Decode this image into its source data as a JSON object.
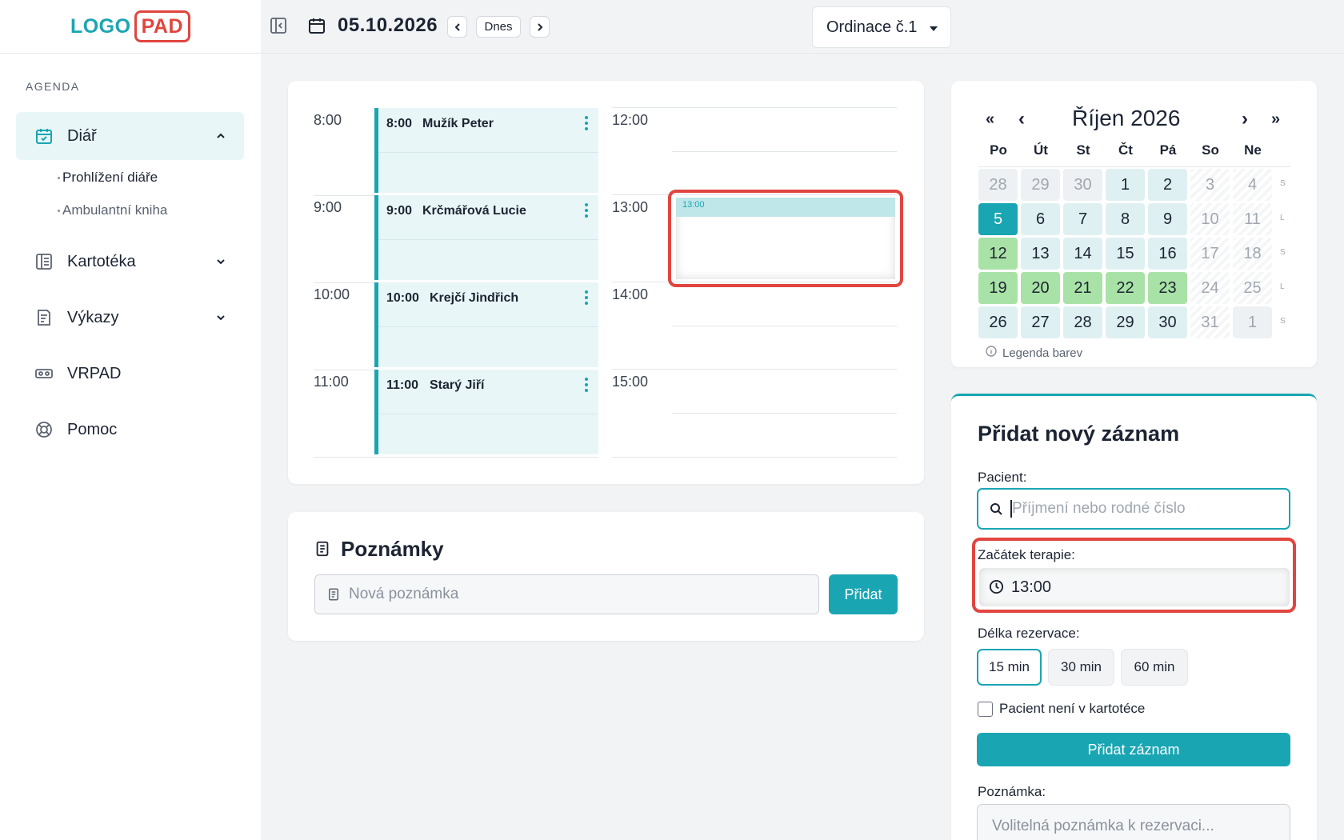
{
  "logo": {
    "part1": "LOGO",
    "part2": "PAD"
  },
  "sidebar": {
    "section_label": "AGENDA",
    "items": [
      {
        "label": "Diář",
        "icon": "calendar-check-icon",
        "active": true
      },
      {
        "label": "Kartotéka",
        "icon": "book-icon"
      },
      {
        "label": "Výkazy",
        "icon": "report-icon"
      },
      {
        "label": "VRPAD",
        "icon": "vr-headset-icon"
      },
      {
        "label": "Pomoc",
        "icon": "lifebuoy-icon"
      }
    ],
    "subitems": [
      {
        "label": "Prohlížení diáře"
      },
      {
        "label": "Ambulantní kniha"
      }
    ]
  },
  "topbar": {
    "date": "05.10.2026",
    "today_label": "Dnes",
    "office_select": "Ordinace č.1"
  },
  "schedule": {
    "times_left": [
      "8:00",
      "9:00",
      "10:00",
      "11:00"
    ],
    "times_right": [
      "12:00",
      "13:00",
      "14:00",
      "15:00"
    ],
    "appointments": [
      {
        "time": "8:00",
        "name": "Mužík Peter"
      },
      {
        "time": "9:00",
        "name": "Krčmářová Lucie"
      },
      {
        "time": "10:00",
        "name": "Krejčí Jindřich"
      },
      {
        "time": "11:00",
        "name": "Starý Jiří"
      }
    ],
    "selected_slot_time": "13:00"
  },
  "notes": {
    "title": "Poznámky",
    "placeholder": "Nová poznámka",
    "add_label": "Přidat"
  },
  "mini_calendar": {
    "title": "Říjen 2026",
    "nav": {
      "first": "«",
      "prev": "‹",
      "next": "›",
      "last": "»"
    },
    "weekdays": [
      "Po",
      "Út",
      "St",
      "Čt",
      "Pá",
      "So",
      "Ne"
    ],
    "weeks": [
      {
        "days": [
          "28",
          "29",
          "30",
          "1",
          "2",
          "3",
          "4"
        ],
        "tag": "S"
      },
      {
        "days": [
          "5",
          "6",
          "7",
          "8",
          "9",
          "10",
          "11"
        ],
        "tag": "L"
      },
      {
        "days": [
          "12",
          "13",
          "14",
          "15",
          "16",
          "17",
          "18"
        ],
        "tag": "S"
      },
      {
        "days": [
          "19",
          "20",
          "21",
          "22",
          "23",
          "24",
          "25"
        ],
        "tag": "L"
      },
      {
        "days": [
          "26",
          "27",
          "28",
          "29",
          "30",
          "31",
          "1"
        ],
        "tag": "S"
      }
    ],
    "selected_day": "5",
    "legend_label": "Legenda barev",
    "colors": {
      "selected": "#1aa5b3",
      "available": "#dff0f2",
      "busy": "#a9e2a6",
      "other_month": "#eef1f3",
      "weekend": "#ffffff"
    }
  },
  "form": {
    "title": "Přidat nový záznam",
    "patient_label": "Pacient:",
    "patient_placeholder": "Příjmení nebo rodné číslo",
    "start_label": "Začátek terapie:",
    "start_value": "13:00",
    "duration_label": "Délka rezervace:",
    "durations": [
      "15 min",
      "30 min",
      "60 min"
    ],
    "selected_duration": "15 min",
    "not_in_registry_label": "Pacient není v kartotéce",
    "submit_label": "Přidat záznam",
    "note_label": "Poznámka:",
    "note_placeholder": "Volitelná poznámka k rezervaci..."
  },
  "accent_color": "#1aa5b3",
  "highlight_color": "#e0453f"
}
